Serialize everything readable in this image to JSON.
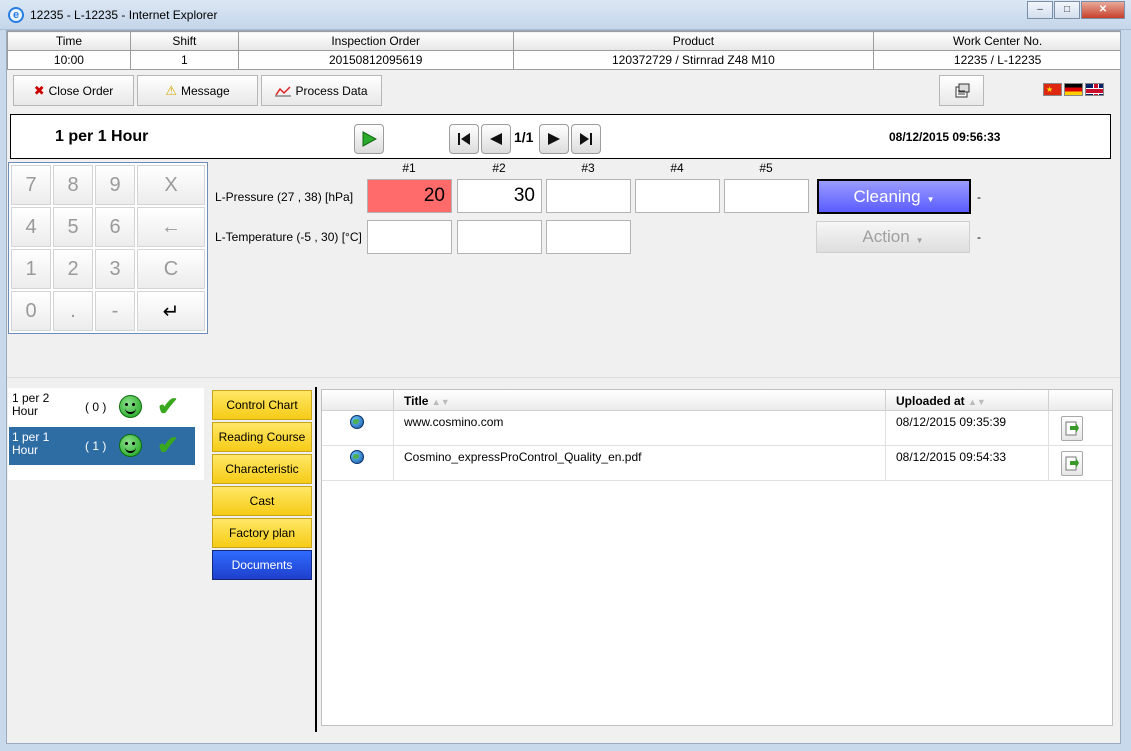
{
  "window": {
    "title": "12235 - L-12235 - Internet Explorer"
  },
  "header": {
    "columns": [
      "Time",
      "Shift",
      "Inspection Order",
      "Product",
      "Work Center No."
    ],
    "values": [
      "10:00",
      "1",
      "20150812095619",
      "120372729  / Stirnrad Z48 M10",
      "12235  / L-12235"
    ]
  },
  "toolbar": {
    "close_order": "Close Order",
    "message": "Message",
    "process_data": "Process Data"
  },
  "interval": {
    "title": "1 per 1 Hour",
    "page": "1/1",
    "datetime": "08/12/2015 09:56:33"
  },
  "keypad": {
    "keys": [
      "7",
      "8",
      "9",
      "X",
      "4",
      "5",
      "6",
      "←",
      "1",
      "2",
      "3",
      "C",
      "0",
      ".",
      "-",
      "↵"
    ]
  },
  "measurements": {
    "sample_headers": [
      "#1",
      "#2",
      "#3",
      "#4",
      "#5"
    ],
    "rows": [
      {
        "label": "L-Pressure (27 , 38) [hPa]",
        "values": [
          "20",
          "30",
          "",
          "",
          ""
        ],
        "action": "Cleaning",
        "suffix": "-"
      },
      {
        "label": "L-Temperature (-5 , 30) [°C]",
        "values": [
          "",
          "",
          ""
        ],
        "action": "Action",
        "suffix": "-"
      }
    ]
  },
  "plans": [
    {
      "name": "1 per 2 Hour",
      "count": "( 0 )",
      "selected": false
    },
    {
      "name": "1 per 1 Hour",
      "count": "( 1 )",
      "selected": true
    }
  ],
  "modules": [
    "Control Chart",
    "Reading Course",
    "Characteristic",
    "Cast",
    "Factory plan",
    "Documents"
  ],
  "documents": {
    "headers": {
      "title": "Title",
      "uploaded": "Uploaded at"
    },
    "rows": [
      {
        "title": "www.cosmino.com",
        "uploaded": "08/12/2015 09:35:39"
      },
      {
        "title": "Cosmino_expressProControl_Quality_en.pdf",
        "uploaded": "08/12/2015 09:54:33"
      }
    ]
  },
  "colors": {
    "alert": "#ff6b6b",
    "selected_plan": "#2e6da4",
    "cleaning": "#5a5cff",
    "module": "#f6cc17",
    "module_active": "#1f3fcc"
  }
}
